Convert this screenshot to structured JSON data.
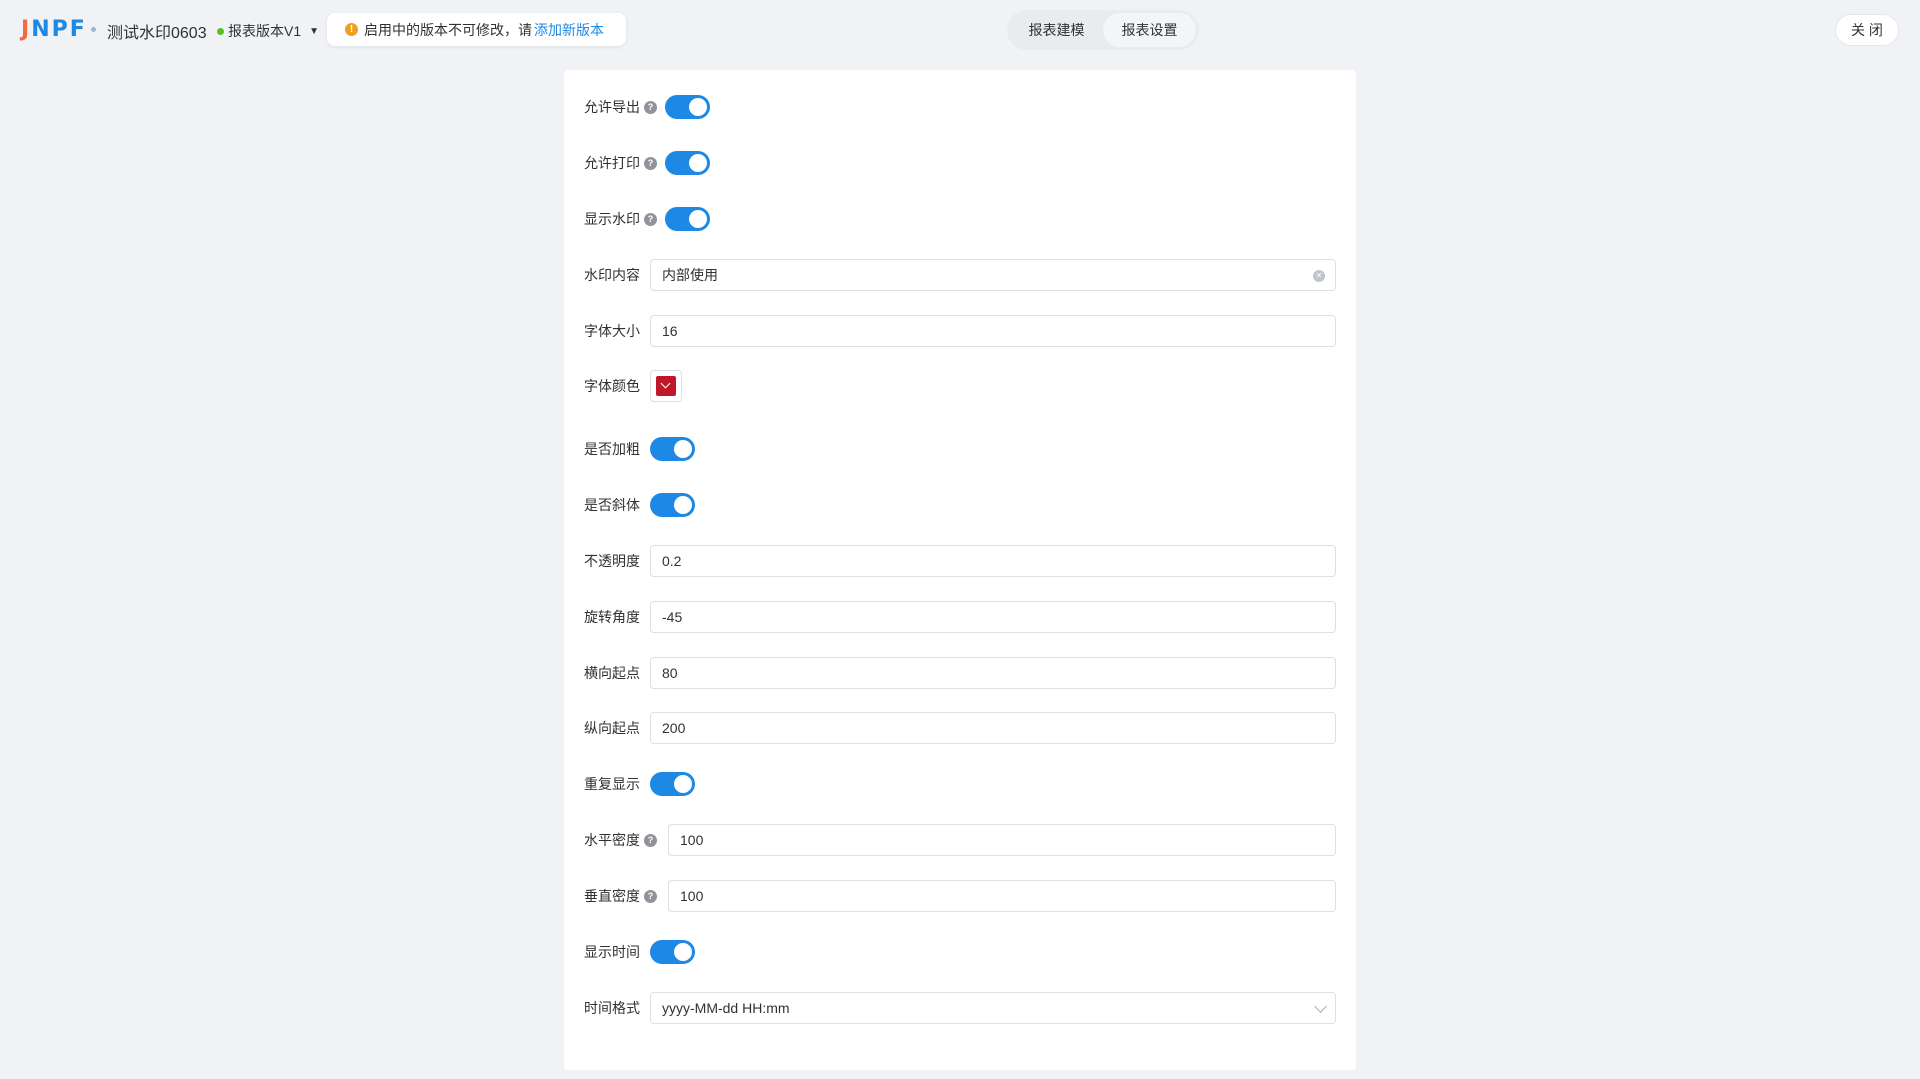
{
  "header": {
    "logo": {
      "j": "J",
      "rest": "NPF"
    },
    "report_title": "测试水印0603",
    "version_label": "报表版本V1",
    "notice_text": "启用中的版本不可修改，请",
    "notice_link": "添加新版本",
    "tabs": [
      {
        "label": "报表建模"
      },
      {
        "label": "报表设置"
      }
    ],
    "close_label": "关 闭"
  },
  "form": {
    "allow_export": {
      "label": "允许导出",
      "value": true
    },
    "allow_print": {
      "label": "允许打印",
      "value": true
    },
    "show_watermark": {
      "label": "显示水印",
      "value": true
    },
    "watermark_content": {
      "label": "水印内容",
      "value": "内部使用"
    },
    "font_size": {
      "label": "字体大小",
      "value": "16"
    },
    "font_color": {
      "label": "字体颜色",
      "value": "#c0172a"
    },
    "bold": {
      "label": "是否加粗",
      "value": true
    },
    "italic": {
      "label": "是否斜体",
      "value": true
    },
    "opacity": {
      "label": "不透明度",
      "value": "0.2"
    },
    "rotation": {
      "label": "旋转角度",
      "value": "-45"
    },
    "x_start": {
      "label": "横向起点",
      "value": "80"
    },
    "y_start": {
      "label": "纵向起点",
      "value": "200"
    },
    "repeat": {
      "label": "重复显示",
      "value": true
    },
    "h_density": {
      "label": "水平密度",
      "value": "100"
    },
    "v_density": {
      "label": "垂直密度",
      "value": "100"
    },
    "show_time": {
      "label": "显示时间",
      "value": true
    },
    "time_format": {
      "label": "时间格式",
      "value": "yyyy-MM-dd HH:mm"
    }
  },
  "colors": {
    "primary": "#1e88e5",
    "logo_orange": "#f56c3c",
    "status_green": "#52c41a",
    "warning": "#f0a020"
  }
}
